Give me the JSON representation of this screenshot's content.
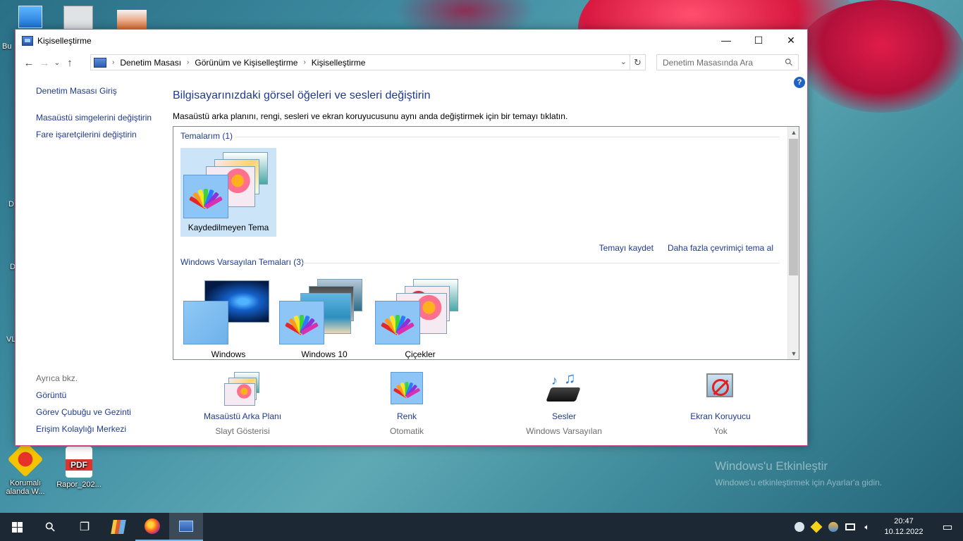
{
  "window": {
    "title": "Kişiselleştirme",
    "controls": {
      "minimize": "—",
      "maximize": "☐",
      "close": "✕"
    }
  },
  "address": {
    "nav_back": "←",
    "nav_forward": "→",
    "nav_up": "↑",
    "crumbs": [
      "Denetim Masası",
      "Görünüm ve Kişiselleştirme",
      "Kişiselleştirme"
    ],
    "dropdown": "⌄",
    "refresh": "↻",
    "search_placeholder": "Denetim Masasında Ara",
    "search_glyph": "⚲"
  },
  "help_label": "?",
  "leftnav": {
    "home": "Denetim Masası Giriş",
    "links": [
      "Masaüstü simgelerini değiştirin",
      "Fare işaretçilerini değiştirin"
    ]
  },
  "seealso": {
    "header": "Ayrıca bkz.",
    "links": [
      "Görüntü",
      "Görev Çubuğu ve Gezinti",
      "Erişim Kolaylığı Merkezi"
    ]
  },
  "main": {
    "heading": "Bilgisayarınızdaki görsel öğeleri ve sesleri değiştirin",
    "subheading": "Masaüstü arka planını, rengi, sesleri ve ekran koruyucusunu aynı anda değiştirmek için bir temayı tıklatın."
  },
  "themes": {
    "my_themes_header": "Temalarım (1)",
    "my_themes": [
      {
        "name": "Kaydedilmeyen Tema",
        "selected": true
      }
    ],
    "save_link": "Temayı kaydet",
    "more_link": "Daha fazla çevrimiçi tema al",
    "default_header": "Windows Varsayılan Temaları (3)",
    "defaults": [
      {
        "name": "Windows"
      },
      {
        "name": "Windows 10"
      },
      {
        "name": "Çiçekler"
      }
    ],
    "scroll_up": "▲",
    "scroll_down": "▼"
  },
  "bottom": [
    {
      "title": "Masaüstü Arka Planı",
      "subtitle": "Slayt Gösterisi"
    },
    {
      "title": "Renk",
      "subtitle": "Otomatik"
    },
    {
      "title": "Sesler",
      "subtitle": "Windows Varsayılan"
    },
    {
      "title": "Ekran Koruyucu",
      "subtitle": "Yok"
    }
  ],
  "desktop": {
    "icons": [
      {
        "label": "Korumalı alanda W..."
      },
      {
        "label": "Rapor_202..."
      }
    ],
    "pdf_badge": "PDF",
    "partial_labels": [
      "Bu",
      "D",
      "D",
      "VL"
    ],
    "watermark_title": "Windows'u Etkinleştir",
    "watermark_text": "Windows'u etkinleştirmek için Ayarlar'a gidin."
  },
  "taskbar": {
    "clock_time": "20:47",
    "clock_date": "10.12.2022",
    "search_glyph": "⚲",
    "taskview_glyph": "❐",
    "notification_glyph": "▭"
  },
  "colors": {
    "accent_link": "#1e3a8f",
    "window_border": "#d54b8a",
    "selection": "#cce4f7",
    "taskbar": "#1c2833"
  }
}
